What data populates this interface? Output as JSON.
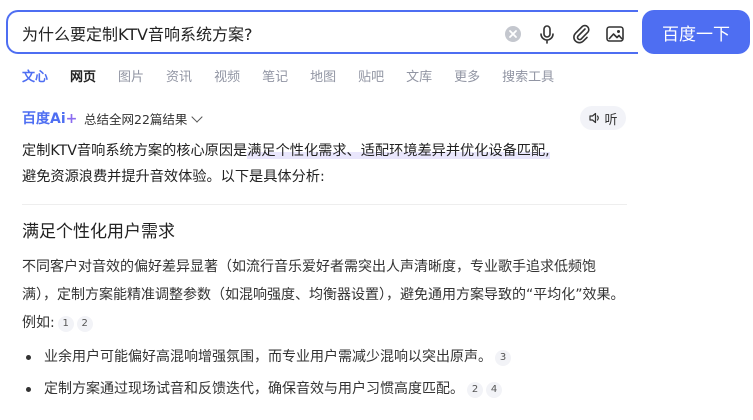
{
  "search": {
    "query": "为什么要定制KTV音响系统方案?",
    "button_label": "百度一下"
  },
  "tabs": [
    "文心",
    "网页",
    "图片",
    "资讯",
    "视频",
    "笔记",
    "地图",
    "贴吧",
    "文库",
    "更多",
    "搜索工具"
  ],
  "ai": {
    "logo_text": "百度",
    "logo_ai": "Ai",
    "logo_star": "+",
    "summary": "总结全网22篇结果",
    "listen_label": "听"
  },
  "answer": {
    "intro_plain": "定制KTV音响系统方案的核心原因是",
    "intro_highlight": "满足个性化需求、适配环境差异并优化设备匹配,",
    "intro_rest": "避免资源浪费并提升音效体验。以下是具体分析:",
    "section_title": "满足个性化用户需求",
    "section_para": "不同客户对音效的偏好差异显著（如流行音乐爱好者需突出人声清晰度，专业歌手追求低频饱满），定制方案能精准调整参数（如混响强度、均衡器设置），避免通用方案导致的“平均化”效果。例如:",
    "section_refs": [
      "1",
      "2"
    ],
    "bullets": [
      {
        "text": "业余用户可能偏好高混响增强氛围，而专业用户需减少混响以突出原声。",
        "refs": [
          "3"
        ]
      },
      {
        "text": "定制方案通过现场试音和反馈迭代，确保音效与用户习惯高度匹配。",
        "refs": [
          "2",
          "4"
        ]
      }
    ]
  },
  "colors": {
    "accent": "#4e6ef2",
    "ai_star": "#8b6cf0"
  },
  "icons": [
    "clear-icon",
    "microphone-icon",
    "paperclip-icon",
    "image-search-icon",
    "speaker-icon",
    "chevron-down-icon"
  ]
}
